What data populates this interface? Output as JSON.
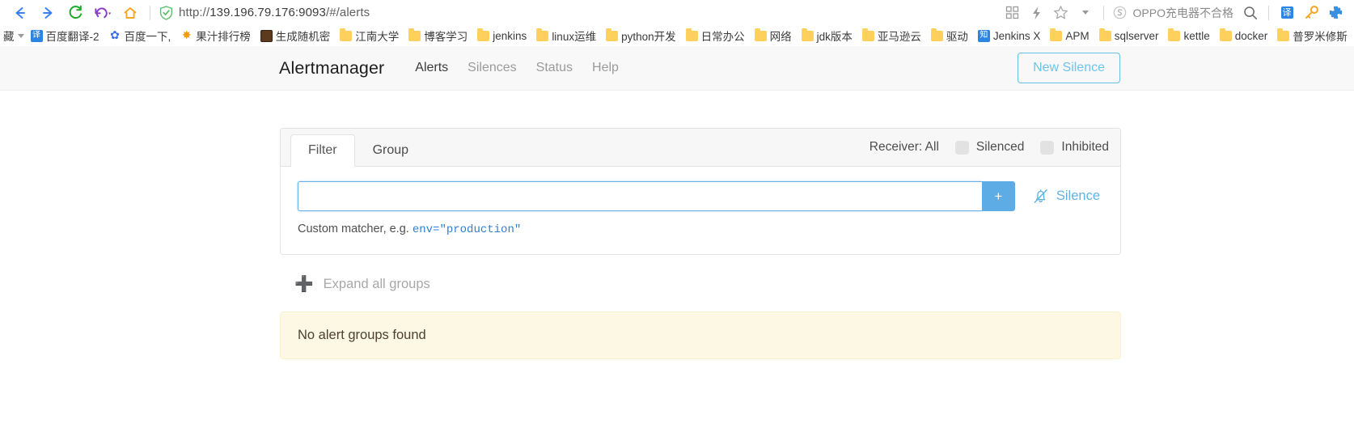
{
  "browser": {
    "nav": {
      "back_icon": "arrow-left-icon",
      "forward_icon": "arrow-right-icon",
      "reload_icon": "reload-icon",
      "history_icon": "undo-history-icon",
      "home_icon": "home-icon"
    },
    "url": {
      "security_icon": "shield-check-icon",
      "scheme": "http://",
      "host": "139.196.79.176:9093",
      "path": "/#/alerts",
      "full": "http://139.196.79.176:9093/#/alerts"
    },
    "toolbar_icons": [
      "grid-apps-icon",
      "lightning-icon",
      "star-bookmark-icon",
      "chevron-down-icon"
    ],
    "search": {
      "engine_icon": "sogou-s-icon",
      "query": "OPPO充电器不合格",
      "search_icon": "search-icon"
    },
    "extensions": [
      "translate-icon",
      "key-password-icon",
      "puzzle-extension-icon"
    ]
  },
  "bookmarks": {
    "overflow_label": "藏",
    "items": [
      {
        "label": "百度翻译-2",
        "icon": "translate-square-icon",
        "icon_type": "blue",
        "glyph": "译"
      },
      {
        "label": "百度一下,",
        "icon": "baidu-paw-icon",
        "icon_type": "paw",
        "glyph": ""
      },
      {
        "label": "果汁排行榜",
        "icon": "juice-icon",
        "icon_type": "orange",
        "glyph": ""
      },
      {
        "label": "生成随机密",
        "icon": "random-password-icon",
        "icon_type": "brown",
        "glyph": ""
      },
      {
        "label": "江南大学",
        "icon": "folder-icon",
        "icon_type": "folder",
        "glyph": ""
      },
      {
        "label": "博客学习",
        "icon": "folder-icon",
        "icon_type": "folder",
        "glyph": ""
      },
      {
        "label": "jenkins",
        "icon": "folder-icon",
        "icon_type": "folder",
        "glyph": ""
      },
      {
        "label": "linux运维",
        "icon": "folder-icon",
        "icon_type": "folder",
        "glyph": ""
      },
      {
        "label": "python开发",
        "icon": "folder-icon",
        "icon_type": "folder",
        "glyph": ""
      },
      {
        "label": "日常办公",
        "icon": "folder-icon",
        "icon_type": "folder",
        "glyph": ""
      },
      {
        "label": "网络",
        "icon": "folder-icon",
        "icon_type": "folder",
        "glyph": ""
      },
      {
        "label": "jdk版本",
        "icon": "folder-icon",
        "icon_type": "folder",
        "glyph": ""
      },
      {
        "label": "亚马逊云",
        "icon": "folder-icon",
        "icon_type": "folder",
        "glyph": ""
      },
      {
        "label": "驱动",
        "icon": "folder-icon",
        "icon_type": "folder",
        "glyph": ""
      },
      {
        "label": "Jenkins X",
        "icon": "zhihu-icon",
        "icon_type": "blue",
        "glyph": "知"
      },
      {
        "label": "APM",
        "icon": "folder-icon",
        "icon_type": "folder",
        "glyph": ""
      },
      {
        "label": "sqlserver",
        "icon": "folder-icon",
        "icon_type": "folder",
        "glyph": ""
      },
      {
        "label": "kettle",
        "icon": "folder-icon",
        "icon_type": "folder",
        "glyph": ""
      },
      {
        "label": "docker",
        "icon": "folder-icon",
        "icon_type": "folder",
        "glyph": ""
      },
      {
        "label": "普罗米修斯",
        "icon": "folder-icon",
        "icon_type": "folder",
        "glyph": ""
      }
    ]
  },
  "app": {
    "brand": "Alertmanager",
    "nav_links": [
      {
        "label": "Alerts",
        "active": true
      },
      {
        "label": "Silences",
        "active": false
      },
      {
        "label": "Status",
        "active": false
      },
      {
        "label": "Help",
        "active": false
      }
    ],
    "new_silence_button": "New Silence",
    "filter_card": {
      "tabs": [
        {
          "label": "Filter",
          "active": true
        },
        {
          "label": "Group",
          "active": false
        }
      ],
      "receiver_label": "Receiver: All",
      "toggles": [
        {
          "label": "Silenced",
          "checked": false
        },
        {
          "label": "Inhibited",
          "checked": false
        }
      ],
      "input_value": "",
      "input_placeholder": "",
      "add_button_label": "+",
      "silence_action_label": "Silence",
      "silence_action_icon": "bell-slash-icon",
      "hint_text": "Custom matcher, e.g.",
      "hint_code": "env=\"production\""
    },
    "expand_all": {
      "icon": "plus-icon",
      "label": "Expand all groups"
    },
    "empty_message": "No alert groups found"
  },
  "colors": {
    "accent_blue": "#5dace6",
    "link_blue": "#6fc3ea",
    "alert_bg": "#fcf8e3",
    "navbar_bg": "#f8f8f8",
    "folder_yellow": "#ffd15c"
  }
}
